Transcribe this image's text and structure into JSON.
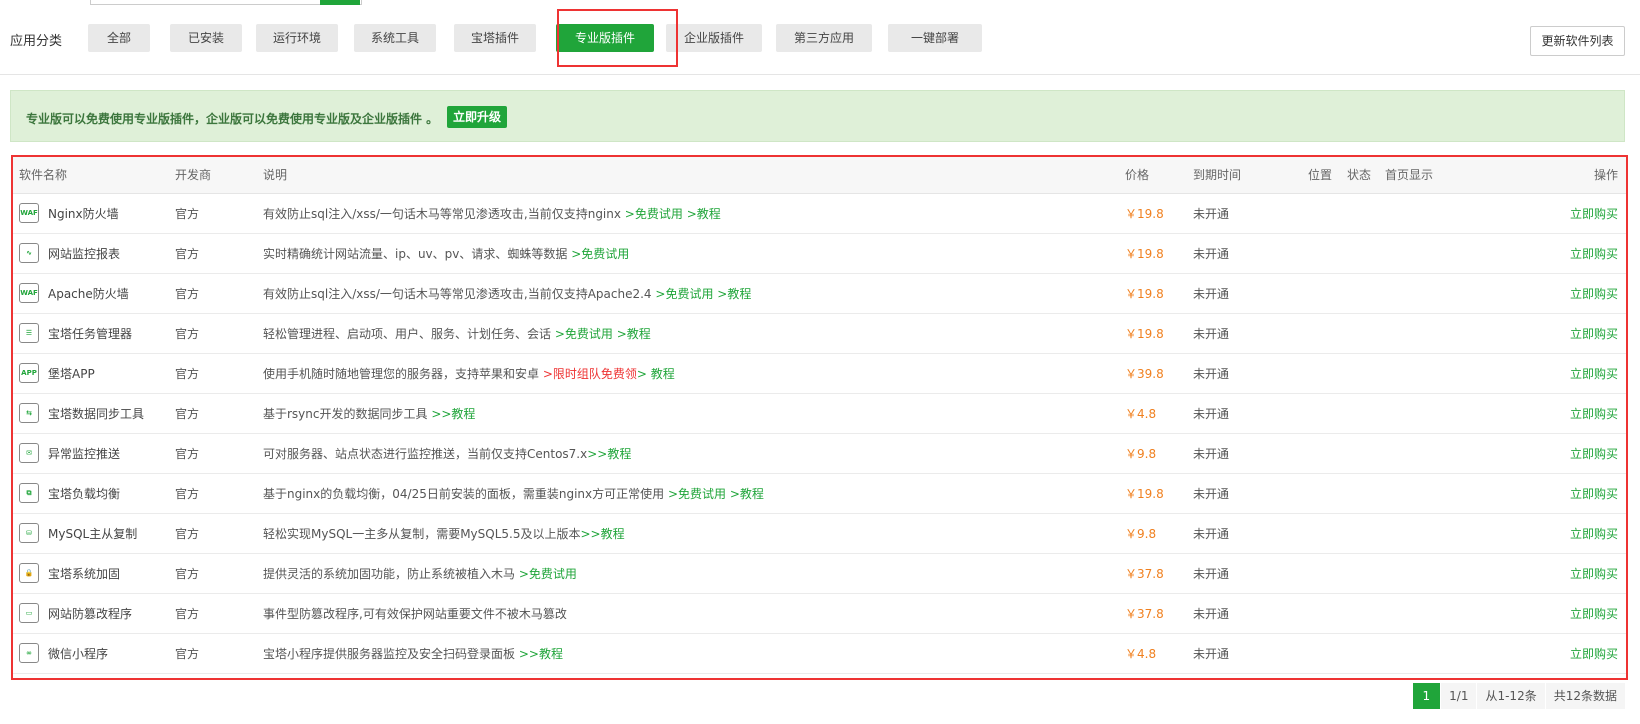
{
  "categories": {
    "label": "应用分类",
    "tabs": [
      {
        "label": "全部",
        "active": false
      },
      {
        "label": "已安装",
        "active": false
      },
      {
        "label": "运行环境",
        "active": false
      },
      {
        "label": "系统工具",
        "active": false
      },
      {
        "label": "宝塔插件",
        "active": false
      },
      {
        "label": "专业版插件",
        "active": true
      },
      {
        "label": "企业版插件",
        "active": false
      },
      {
        "label": "第三方应用",
        "active": false
      },
      {
        "label": "一键部署",
        "active": false
      }
    ],
    "refresh_label": "更新软件列表"
  },
  "notice": {
    "text": "专业版可以免费使用专业版插件，企业版可以免费使用专业版及企业版插件 。",
    "upgrade_label": "立即升级"
  },
  "table": {
    "headers": {
      "name": "软件名称",
      "developer": "开发商",
      "description": "说明",
      "price": "价格",
      "expiry": "到期时间",
      "position": "位置",
      "status": "状态",
      "homepage": "首页显示",
      "action": "操作"
    },
    "rows": [
      {
        "icon": "waf-shield-icon",
        "name": "Nginx防火墙",
        "developer": "官方",
        "description": "有效防止sql注入/xss/一句话木马等常见渗透攻击,当前仅支持nginx ",
        "links": [
          ">免费试用",
          ">教程"
        ],
        "red_link": "",
        "price": "￥19.8",
        "expiry": "未开通",
        "action": "立即购买"
      },
      {
        "icon": "chart-monitor-icon",
        "name": "网站监控报表",
        "developer": "官方",
        "description": "实时精确统计网站流量、ip、uv、pv、请求、蜘蛛等数据 ",
        "links": [
          ">免费试用"
        ],
        "red_link": "",
        "price": "￥19.8",
        "expiry": "未开通",
        "action": "立即购买"
      },
      {
        "icon": "waf-shield-icon",
        "name": "Apache防火墙",
        "developer": "官方",
        "description": "有效防止sql注入/xss/一句话木马等常见渗透攻击,当前仅支持Apache2.4 ",
        "links": [
          ">免费试用",
          ">教程"
        ],
        "red_link": "",
        "price": "￥19.8",
        "expiry": "未开通",
        "action": "立即购买"
      },
      {
        "icon": "task-list-icon",
        "name": "宝塔任务管理器",
        "developer": "官方",
        "description": "轻松管理进程、启动项、用户、服务、计划任务、会话 ",
        "links": [
          ">免费试用",
          ">教程"
        ],
        "red_link": "",
        "price": "￥19.8",
        "expiry": "未开通",
        "action": "立即购买"
      },
      {
        "icon": "app-icon",
        "name": "堡塔APP",
        "developer": "官方",
        "description": "使用手机随时随地管理您的服务器，支持苹果和安卓 ",
        "links": [
          "> 教程"
        ],
        "red_link": ">限时组队免费领",
        "price": "￥39.8",
        "expiry": "未开通",
        "action": "立即购买"
      },
      {
        "icon": "folder-sync-icon",
        "name": "宝塔数据同步工具",
        "developer": "官方",
        "description": "基于rsync开发的数据同步工具 ",
        "links": [
          ">>教程"
        ],
        "red_link": "",
        "price": "￥4.8",
        "expiry": "未开通",
        "action": "立即购买"
      },
      {
        "icon": "mail-push-icon",
        "name": "异常监控推送",
        "developer": "官方",
        "description": "可对服务器、站点状态进行监控推送，当前仅支持Centos7.x",
        "links": [
          ">>教程"
        ],
        "red_link": "",
        "price": "￥9.8",
        "expiry": "未开通",
        "action": "立即购买"
      },
      {
        "icon": "load-balance-icon",
        "name": "宝塔负载均衡",
        "developer": "官方",
        "description": "基于nginx的负载均衡，04/25日前安装的面板，需重装nginx方可正常使用 ",
        "links": [
          ">免费试用",
          ">教程"
        ],
        "red_link": "",
        "price": "￥19.8",
        "expiry": "未开通",
        "action": "立即购买"
      },
      {
        "icon": "database-icon",
        "name": "MySQL主从复制",
        "developer": "官方",
        "description": "轻松实现MySQL一主多从复制，需要MySQL5.5及以上版本",
        "links": [
          ">>教程"
        ],
        "red_link": "",
        "price": "￥9.8",
        "expiry": "未开通",
        "action": "立即购买"
      },
      {
        "icon": "lock-shield-icon",
        "name": "宝塔系统加固",
        "developer": "官方",
        "description": "提供灵活的系统加固功能，防止系统被植入木马 ",
        "links": [
          ">免费试用"
        ],
        "red_link": "",
        "price": "￥37.8",
        "expiry": "未开通",
        "action": "立即购买"
      },
      {
        "icon": "browser-lock-icon",
        "name": "网站防篡改程序",
        "developer": "官方",
        "description": "事件型防篡改程序,可有效保护网站重要文件不被木马篡改",
        "links": [],
        "red_link": "",
        "price": "￥37.8",
        "expiry": "未开通",
        "action": "立即购买"
      },
      {
        "icon": "mini-program-icon",
        "name": "微信小程序",
        "developer": "官方",
        "description": "宝塔小程序提供服务器监控及安全扫码登录面板 ",
        "links": [
          ">>教程"
        ],
        "red_link": "",
        "price": "￥4.8",
        "expiry": "未开通",
        "action": "立即购买"
      }
    ]
  },
  "pagination": {
    "current": "1",
    "pages": "1/1",
    "range": "从1-12条",
    "total": "共12条数据"
  },
  "colors": {
    "accent": "#20a53a",
    "price": "#f0801f",
    "highlight": "#e33333"
  }
}
